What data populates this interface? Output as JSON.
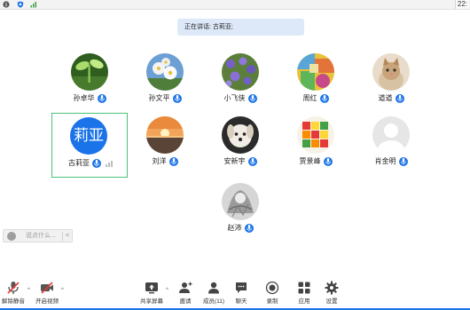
{
  "status_bar": {
    "time": "22:",
    "icons": [
      "info-icon",
      "shield-icon",
      "signal-icon"
    ]
  },
  "speaking_banner": "正在讲话: 古莉亚;",
  "participants": [
    {
      "name": "孙卓华",
      "avatar": "green-plant-photo"
    },
    {
      "name": "孙文平",
      "avatar": "white-flowers-photo"
    },
    {
      "name": "小飞侠",
      "avatar": "purple-flowers-photo"
    },
    {
      "name": "周红",
      "avatar": "colorful-painting-photo"
    },
    {
      "name": "道道",
      "avatar": "kitten-photo"
    },
    {
      "name": "古莉亚",
      "avatar_text": "莉亚",
      "speaking": true
    },
    {
      "name": "刘洋",
      "avatar": "sunset-photo"
    },
    {
      "name": "安新宇",
      "avatar": "puppy-photo"
    },
    {
      "name": "贾景峰",
      "avatar": "rubiks-cube-photo"
    },
    {
      "name": "肖金明",
      "avatar": "default-person-icon"
    },
    {
      "name": "赵沛",
      "avatar": "sketch-photo"
    }
  ],
  "chat": {
    "placeholder": "说点什么...",
    "collapse_icon": "chevron-left-icon"
  },
  "toolbar": {
    "unmute": "解除静音",
    "start_video": "开启视频",
    "share_screen": "共享屏幕",
    "invite": "邀请",
    "members": "成员(11)",
    "chat": "聊天",
    "record": "录制",
    "apps": "应用",
    "settings": "设置"
  },
  "colors": {
    "accent": "#1a73e8",
    "speaking_border": "#4cc27a",
    "banner_bg": "#dde9f9",
    "muted_red": "#e53935"
  }
}
